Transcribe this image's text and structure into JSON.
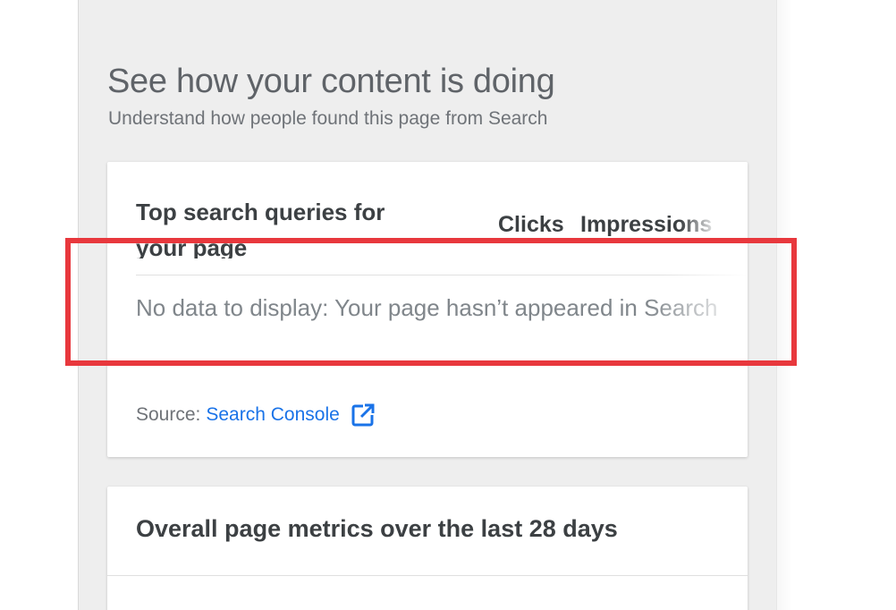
{
  "section": {
    "title": "See how your content is doing",
    "subtitle": "Understand how people found this page from Search"
  },
  "queries_card": {
    "title": "Top search queries for your page",
    "columns": [
      "Clicks",
      "Impressions"
    ],
    "empty_message": "No data to display: Your page hasn’t appeared in Search",
    "source_label": "Source:",
    "source_link": "Search Console",
    "source_icon": "open-in-new-icon"
  },
  "metrics_card": {
    "title": "Overall page metrics over the last 28 days"
  },
  "colors": {
    "highlight": "#e8383d",
    "link": "#1a73e8"
  }
}
